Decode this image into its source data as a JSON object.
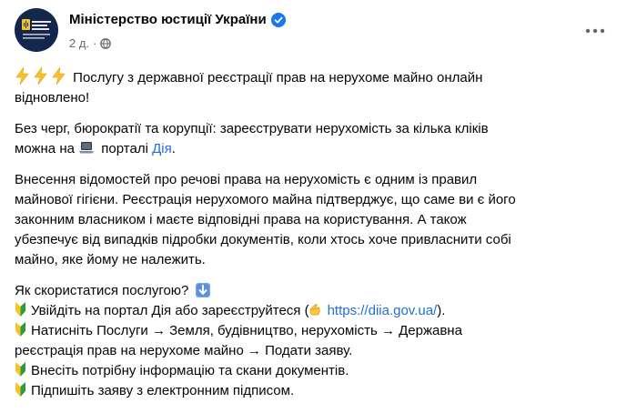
{
  "header": {
    "page_name": "Міністерство юстиції України",
    "timestamp": "2 д.",
    "avatar_text": "МІНІСТЕРСТВО ЮСТИЦІЇ УКРАЇНИ",
    "colors": {
      "avatar_bg": "#15264d",
      "verified": "#1877f2",
      "link": "#216fdb",
      "secondary_text": "#65676b"
    },
    "icons": [
      "verified-badge-icon",
      "globe-icon",
      "more-options-icon"
    ]
  },
  "post": {
    "p1": {
      "line1": "Послугу з державної реєстрації прав на нерухоме майно онлайн",
      "line2": "відновлено!"
    },
    "p2": {
      "line1": "Без черг, бюрократії та корупції: зареєструвати нерухомість за кілька кліків",
      "line2_before": "можна на",
      "line2_mid": " порталі ",
      "link": "Дія",
      "line2_after": "."
    },
    "p3": {
      "line1": "Внесення відомостей про речові права на нерухомість є одним із правил",
      "line2": "майнової гігієни.  Реєстрація нерухомого майна підтверджує, що саме ви є його",
      "line3": "законним власником і маєте відповідні права на користування. А також",
      "line4": "убезпечує від випадків підробки документів, коли хтось хоче привласнити собі",
      "line5": "майно, яке йому не належить."
    },
    "p4": {
      "question": "Як скористатися послугою?",
      "step1_before": "Увійдіть на портал Дія або зареєструйтеся (",
      "step1_link": "https://diia.gov.ua/",
      "step1_after": ").",
      "step2_line1": "Натисніть Послуги → Земля, будівництво, нерухомість → Державна",
      "step2_line2": "реєстрація прав на нерухоме майно → Подати заяву.",
      "step3": "Внесіть потрібну інформацію та скани документів.",
      "step4": "Підпишіть заяву з електронним підписом."
    }
  }
}
